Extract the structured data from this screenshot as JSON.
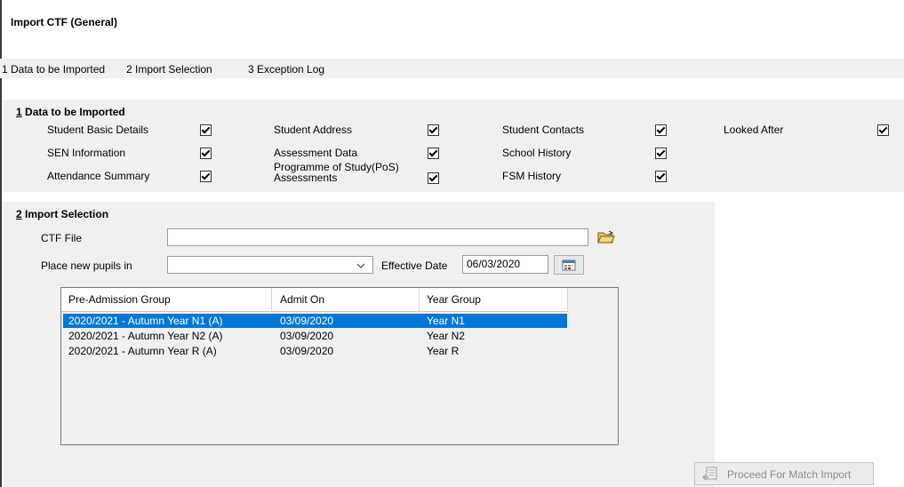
{
  "window": {
    "title": "Import CTF (General)"
  },
  "tabs": [
    "1 Data to be Imported",
    "2 Import Selection",
    "3 Exception Log"
  ],
  "data_to_import": {
    "number": "1",
    "title": " Data to be Imported",
    "items": [
      {
        "label": "Student Basic Details",
        "checked": true
      },
      {
        "label": "Student Address",
        "checked": true
      },
      {
        "label": "Student Contacts",
        "checked": true
      },
      {
        "label": "Looked After",
        "checked": true
      },
      {
        "label": "SEN Information",
        "checked": true
      },
      {
        "label": "Assessment Data",
        "checked": true
      },
      {
        "label": "School History",
        "checked": true
      },
      {
        "label": "Attendance Summary",
        "checked": true
      },
      {
        "label_line1": "Programme of Study(PoS)",
        "label_line2": "Assessments",
        "checked": true
      },
      {
        "label": "FSM History",
        "checked": true
      }
    ]
  },
  "import_selection": {
    "number": "2",
    "title": " Import Selection",
    "ctf_file_label": "CTF File",
    "ctf_file_value": "",
    "place_new_pupils_label": "Place new pupils in",
    "place_new_pupils_value": "",
    "effective_date_label": "Effective Date",
    "effective_date_value": "06/03/2020"
  },
  "grid": {
    "columns": [
      "Pre-Admission Group",
      "Admit On",
      "Year Group"
    ],
    "rows": [
      {
        "group": "2020/2021 - Autumn Year N1 (A)",
        "admit_on": "03/09/2020",
        "year_group": "Year N1",
        "selected": true
      },
      {
        "group": "2020/2021 - Autumn Year  N2 (A)",
        "admit_on": "03/09/2020",
        "year_group": "Year  N2",
        "selected": false
      },
      {
        "group": "2020/2021 - Autumn Year  R (A)",
        "admit_on": "03/09/2020",
        "year_group": "Year  R",
        "selected": false
      }
    ]
  },
  "proceed_button": {
    "label": "Proceed For Match  Import",
    "enabled": false
  },
  "colors": {
    "selection": "#0078d7",
    "panel": "#f0f0f0"
  }
}
